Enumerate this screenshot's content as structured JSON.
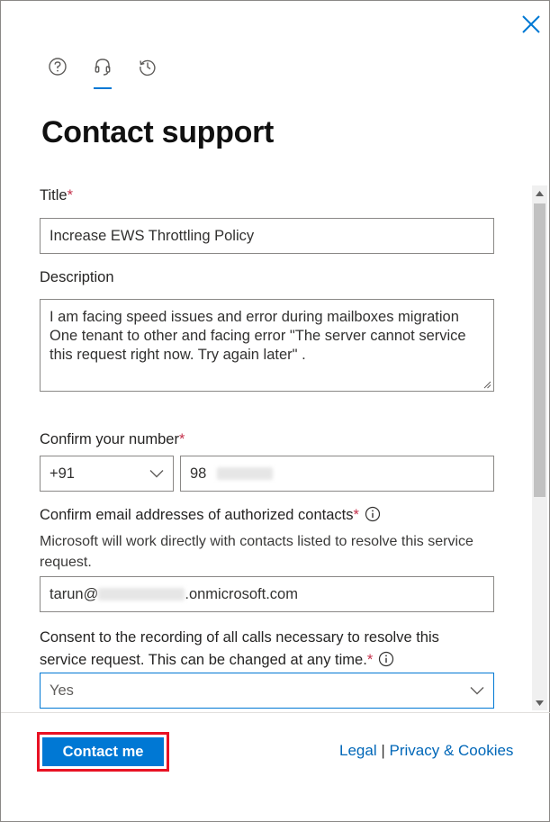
{
  "header": {
    "title": "Contact support",
    "tabs": [
      {
        "icon": "help-icon"
      },
      {
        "icon": "headset-icon",
        "active": true
      },
      {
        "icon": "history-icon"
      }
    ]
  },
  "form": {
    "title_label": "Title",
    "title_value": "Increase EWS Throttling Policy",
    "description_label": "Description",
    "description_value": "I am facing speed issues and error during mailboxes migration One tenant to other and facing error \"The server cannot service this request right now. Try again later\" .",
    "phone_label": "Confirm your number",
    "country_code": "+91",
    "phone_value": "98",
    "email_label": "Confirm email addresses of authorized contacts",
    "email_helper": "Microsoft will work directly with contacts listed to resolve this service request.",
    "email_prefix": "tarun@",
    "email_suffix": ".onmicrosoft.com",
    "consent_label": "Consent to the recording of all calls necessary to resolve this service request. This can be changed at any time.",
    "consent_value": "Yes",
    "required_mark": "*"
  },
  "footer": {
    "contact_button": "Contact me",
    "legal_link": "Legal",
    "separator": "|",
    "privacy_link": "Privacy & Cookies"
  },
  "colors": {
    "accent": "#0078d4",
    "required": "#c4314b",
    "highlight": "#e81123"
  }
}
